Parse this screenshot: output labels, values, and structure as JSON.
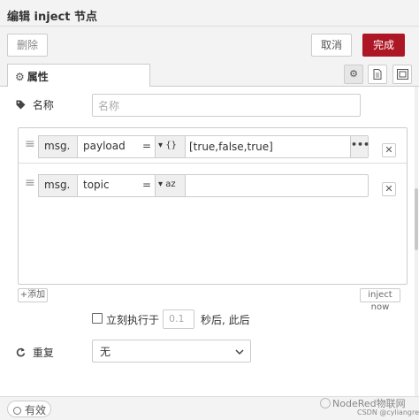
{
  "dialog": {
    "title": "编辑 inject 节点"
  },
  "toolbar": {
    "delete_label": "删除",
    "cancel_label": "取消",
    "done_label": "完成"
  },
  "tabs": {
    "properties_label": "属性",
    "properties_icon": "gear-icon",
    "icons": [
      "gear-icon",
      "document-icon",
      "frame-icon"
    ]
  },
  "form": {
    "name_label": "名称",
    "name_placeholder": "名称",
    "properties": [
      {
        "prefix": "msg.",
        "key": "payload",
        "type_glyph": "{}",
        "value": "[true,false,true]",
        "ellipsis": "•••"
      },
      {
        "prefix": "msg.",
        "key": "topic",
        "type_glyph": "az",
        "value": ""
      }
    ],
    "equals": "=",
    "add_label": "+添加",
    "inject_now_label": "inject now",
    "once_label": "立刻执行于",
    "delay_placeholder": "0.1",
    "after_label": "秒后, 此后",
    "repeat_label": "重复",
    "repeat_value": "无"
  },
  "footer": {
    "status_label": "有效"
  },
  "watermark": {
    "brand": "NodeRed物联网",
    "credit": "CSDN @cyliangren"
  },
  "colors": {
    "done_button": "#ad1625"
  }
}
